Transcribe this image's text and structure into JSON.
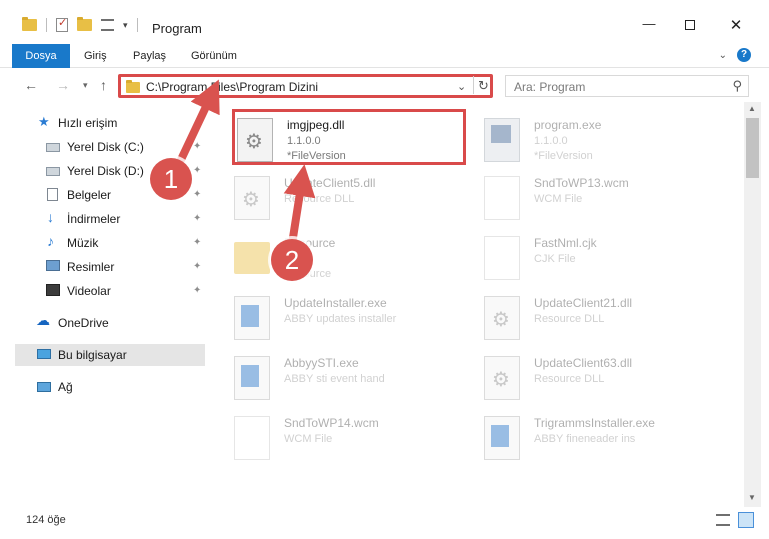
{
  "window": {
    "title": "Program",
    "minimize": "—",
    "close": "✕"
  },
  "ribbon": {
    "tabs": [
      "Dosya",
      "Giriş",
      "Paylaş",
      "Görünüm"
    ],
    "expand": "⌄",
    "help": "?"
  },
  "nav": {
    "back": "←",
    "forward": "→",
    "recent": "▾",
    "up": "↑",
    "address": "C:\\Program Files\\Program Dizini",
    "address_dropdown": "⌄",
    "refresh": "↻",
    "search_placeholder": "Ara: Program",
    "search_icon": "⚲"
  },
  "sidebar": {
    "items": [
      {
        "label": "Hızlı erişim",
        "icon": "star-icon",
        "pinned": false
      },
      {
        "label": "Yerel Disk (C:)",
        "icon": "disk-icon",
        "pinned": true
      },
      {
        "label": "Yerel Disk (D:)",
        "icon": "disk-icon",
        "pinned": true
      },
      {
        "label": "Belgeler",
        "icon": "document-icon",
        "pinned": true
      },
      {
        "label": "İndirmeler",
        "icon": "download-icon",
        "pinned": true
      },
      {
        "label": "Müzik",
        "icon": "music-icon",
        "pinned": true
      },
      {
        "label": "Resimler",
        "icon": "pictures-icon",
        "pinned": true
      },
      {
        "label": "Videolar",
        "icon": "video-icon",
        "pinned": true
      },
      {
        "label": "OneDrive",
        "icon": "cloud-icon",
        "pinned": false
      },
      {
        "label": "Bu bilgisayar",
        "icon": "computer-icon",
        "pinned": false,
        "selected": true
      },
      {
        "label": "Ağ",
        "icon": "network-icon",
        "pinned": false
      }
    ],
    "pin_glyph": "📌"
  },
  "files": [
    {
      "name": "imgjpeg.dll",
      "line2": "1.1.0.0",
      "line3": "*FileVersion",
      "thumb": "gear-file-icon",
      "highlighted": true
    },
    {
      "name": "program.exe",
      "line2": "1.1.0.0",
      "line3": "*FileVersion",
      "thumb": "exe-icon"
    },
    {
      "name": "UpdateClient5.dll",
      "line2": "Resource DLL",
      "line3": "",
      "thumb": "gear-file-icon"
    },
    {
      "name": "SndToWP13.wcm",
      "line2": "WCM File",
      "line3": "",
      "thumb": "blank-file-icon"
    },
    {
      "name": "Resource",
      "line2": "",
      "line3": "Resource",
      "thumb": "folder-icon"
    },
    {
      "name": "FastNml.cjk",
      "line2": "CJK File",
      "line3": "",
      "thumb": "blank-file-icon"
    },
    {
      "name": "UpdateInstaller.exe",
      "line2": "ABBY updates installer",
      "line3": "",
      "thumb": "app-icon"
    },
    {
      "name": "UpdateClient21.dll",
      "line2": "Resource DLL",
      "line3": "",
      "thumb": "gear-file-icon"
    },
    {
      "name": "AbbyySTI.exe",
      "line2": "ABBY sti event hand",
      "line3": "",
      "thumb": "app-icon"
    },
    {
      "name": "UpdateClient63.dll",
      "line2": "Resource DLL",
      "line3": "",
      "thumb": "gear-file-icon"
    },
    {
      "name": "SndToWP14.wcm",
      "line2": "WCM File",
      "line3": "",
      "thumb": "blank-file-icon"
    },
    {
      "name": "TrigrammsInstaller.exe",
      "line2": "ABBY fineneader ins",
      "line3": "",
      "thumb": "app-icon"
    }
  ],
  "status": {
    "count": "124 öğe"
  },
  "annotations": {
    "step1": "1",
    "step2": "2",
    "color": "#d9534f"
  },
  "colors": {
    "accent": "#1979ca",
    "highlight_border": "#d94a4a"
  }
}
